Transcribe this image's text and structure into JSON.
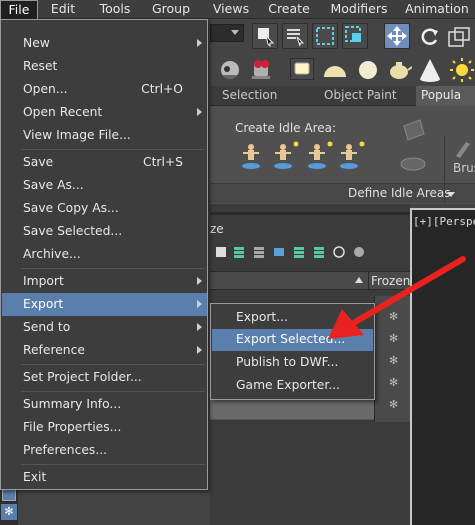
{
  "menubar": {
    "items": [
      {
        "label": "File"
      },
      {
        "label": "Edit"
      },
      {
        "label": "Tools"
      },
      {
        "label": "Group"
      },
      {
        "label": "Views"
      },
      {
        "label": "Create"
      },
      {
        "label": "Modifiers"
      },
      {
        "label": "Animation"
      }
    ]
  },
  "file_menu": {
    "items": [
      {
        "label": "New",
        "has_submenu": true
      },
      {
        "label": "Reset"
      },
      {
        "label": "Open...",
        "shortcut": "Ctrl+O"
      },
      {
        "label": "Open Recent",
        "has_submenu": true
      },
      {
        "label": "View Image File..."
      },
      {
        "label": "Save",
        "shortcut": "Ctrl+S"
      },
      {
        "label": "Save As..."
      },
      {
        "label": "Save Copy As..."
      },
      {
        "label": "Save Selected..."
      },
      {
        "label": "Archive..."
      },
      {
        "label": "Import",
        "has_submenu": true
      },
      {
        "label": "Export",
        "has_submenu": true,
        "highlighted": true
      },
      {
        "label": "Send to",
        "has_submenu": true
      },
      {
        "label": "Reference",
        "has_submenu": true
      },
      {
        "label": "Set Project Folder..."
      },
      {
        "label": "Summary Info..."
      },
      {
        "label": "File Properties..."
      },
      {
        "label": "Preferences..."
      },
      {
        "label": "Exit"
      }
    ]
  },
  "export_submenu": {
    "items": [
      {
        "label": "Export..."
      },
      {
        "label": "Export Selected...",
        "highlighted": true
      },
      {
        "label": "Publish to DWF..."
      },
      {
        "label": "Game Exporter..."
      }
    ]
  },
  "ribbon": {
    "tabs": [
      "Selection",
      "Object Paint",
      "Popula"
    ],
    "section_label": "Create Idle Area:",
    "footer_label": "Define Idle Areas",
    "brush_label": "Brus"
  },
  "scene_explorer": {
    "title_fragment": "ze",
    "column_header": "Frozen"
  },
  "viewport": {
    "label": "[+][Perspec"
  },
  "colors": {
    "highlight": "#5a7fad",
    "menu_bg": "#3d3d3d",
    "annotation_arrow": "#e8231f"
  }
}
